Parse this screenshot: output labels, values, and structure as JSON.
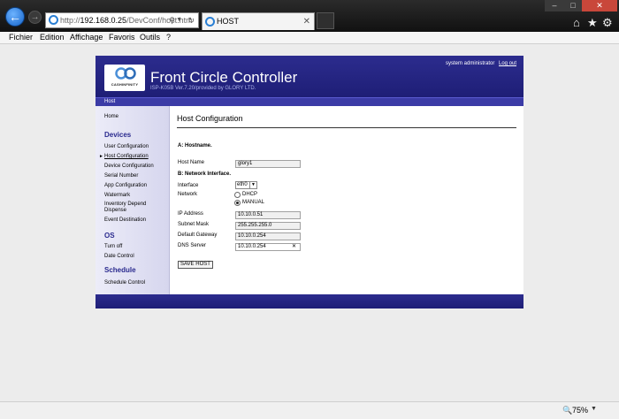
{
  "browser": {
    "url_prefix": "http://",
    "url_host": "192.168.0.25",
    "url_path": "/DevConf/host.htm",
    "tab_title": "HOST",
    "menu": [
      "Fichier",
      "Edition",
      "Affichage",
      "Favoris",
      "Outils",
      "?"
    ],
    "zoom": "75%"
  },
  "app": {
    "title": "Front Circle Controller",
    "version": "ISP-K05B Ver.7.20/provided by GLORY LTD.",
    "logo_text": "CASHINFINITY",
    "user": "system administrator",
    "logout": "Log out",
    "breadcrumb": "Host"
  },
  "sidebar": {
    "home": "Home",
    "sections": [
      {
        "title": "Devices",
        "items": [
          "User Configuration",
          "Host Configuration",
          "Device Configuration",
          "Serial Number",
          "App Configuration",
          "Watermark",
          "Inventory Depend Dispense",
          "Event Destination"
        ]
      },
      {
        "title": "OS",
        "items": [
          "Turn off",
          "Date Control"
        ]
      },
      {
        "title": "Schedule",
        "items": [
          "Schedule Control"
        ]
      }
    ],
    "active_item": "Host Configuration"
  },
  "content": {
    "title": "Host Configuration",
    "section_a": "A: Hostname.",
    "section_b": "B: Network Interface.",
    "fields": {
      "host_name": {
        "label": "Host Name",
        "value": "glory1"
      },
      "interface": {
        "label": "Interface",
        "value": "eth0"
      },
      "network": {
        "label": "Network",
        "options": [
          "DHCP",
          "MANUAL"
        ],
        "selected": "MANUAL"
      },
      "ip_address": {
        "label": "IP Address",
        "value": "10.10.0.51"
      },
      "subnet_mask": {
        "label": "Subnet Mask",
        "value": "255.255.255.0"
      },
      "default_gateway": {
        "label": "Default Gateway",
        "value": "10.10.0.254"
      },
      "dns_server": {
        "label": "DNS Server",
        "value": "10.10.0.254"
      }
    },
    "save_button": "SAVE HOST"
  },
  "colors": {
    "header_blue": "#2c2c8e",
    "section_blue": "#2a2a8e",
    "logo_ring": "#4a8fd8"
  }
}
